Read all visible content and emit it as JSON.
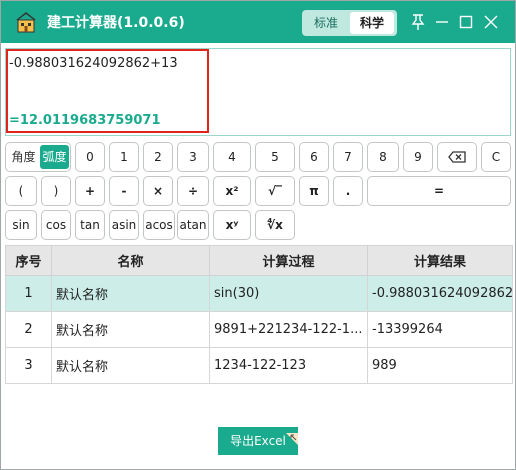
{
  "app": {
    "title": "建工计算器(1.0.0.6)"
  },
  "modes": {
    "standard": "标准",
    "scientific": "科学",
    "active": "科学"
  },
  "window_controls": [
    "pin-icon",
    "minimize-icon",
    "maximize-icon",
    "close-icon"
  ],
  "display": {
    "expression": "-0.988031624092862+13",
    "result": "=12.0119683759071"
  },
  "angle_mode": {
    "degrees": "角度",
    "radians": "弧度",
    "active": "弧度"
  },
  "keys": {
    "row1": [
      "0",
      "1",
      "2",
      "3",
      "4",
      "5",
      "6",
      "7",
      "8",
      "9",
      "backspace-icon",
      "C"
    ],
    "row2": [
      "(",
      ")",
      "+",
      "-",
      "×",
      "÷",
      "x²",
      "√‾",
      "π",
      ".",
      "="
    ],
    "row3": [
      "sin",
      "cos",
      "tan",
      "asin",
      "acos",
      "atan",
      "xʸ",
      "∜x"
    ]
  },
  "table": {
    "headers": [
      "序号",
      "名称",
      "计算过程",
      "计算结果"
    ],
    "rows": [
      {
        "index": "1",
        "name": "默认名称",
        "process": "sin(30)",
        "result": "-0.988031624092862"
      },
      {
        "index": "2",
        "name": "默认名称",
        "process": "9891+221234-122-1...",
        "result": "-13399264"
      },
      {
        "index": "3",
        "name": "默认名称",
        "process": "1234-122-123",
        "result": "989"
      }
    ],
    "selected_row": 1
  },
  "export_button": "导出Excel",
  "colors": {
    "accent": "#1aaa8e",
    "highlight_border": "#e0251f",
    "selected_row": "#cdeee8"
  }
}
